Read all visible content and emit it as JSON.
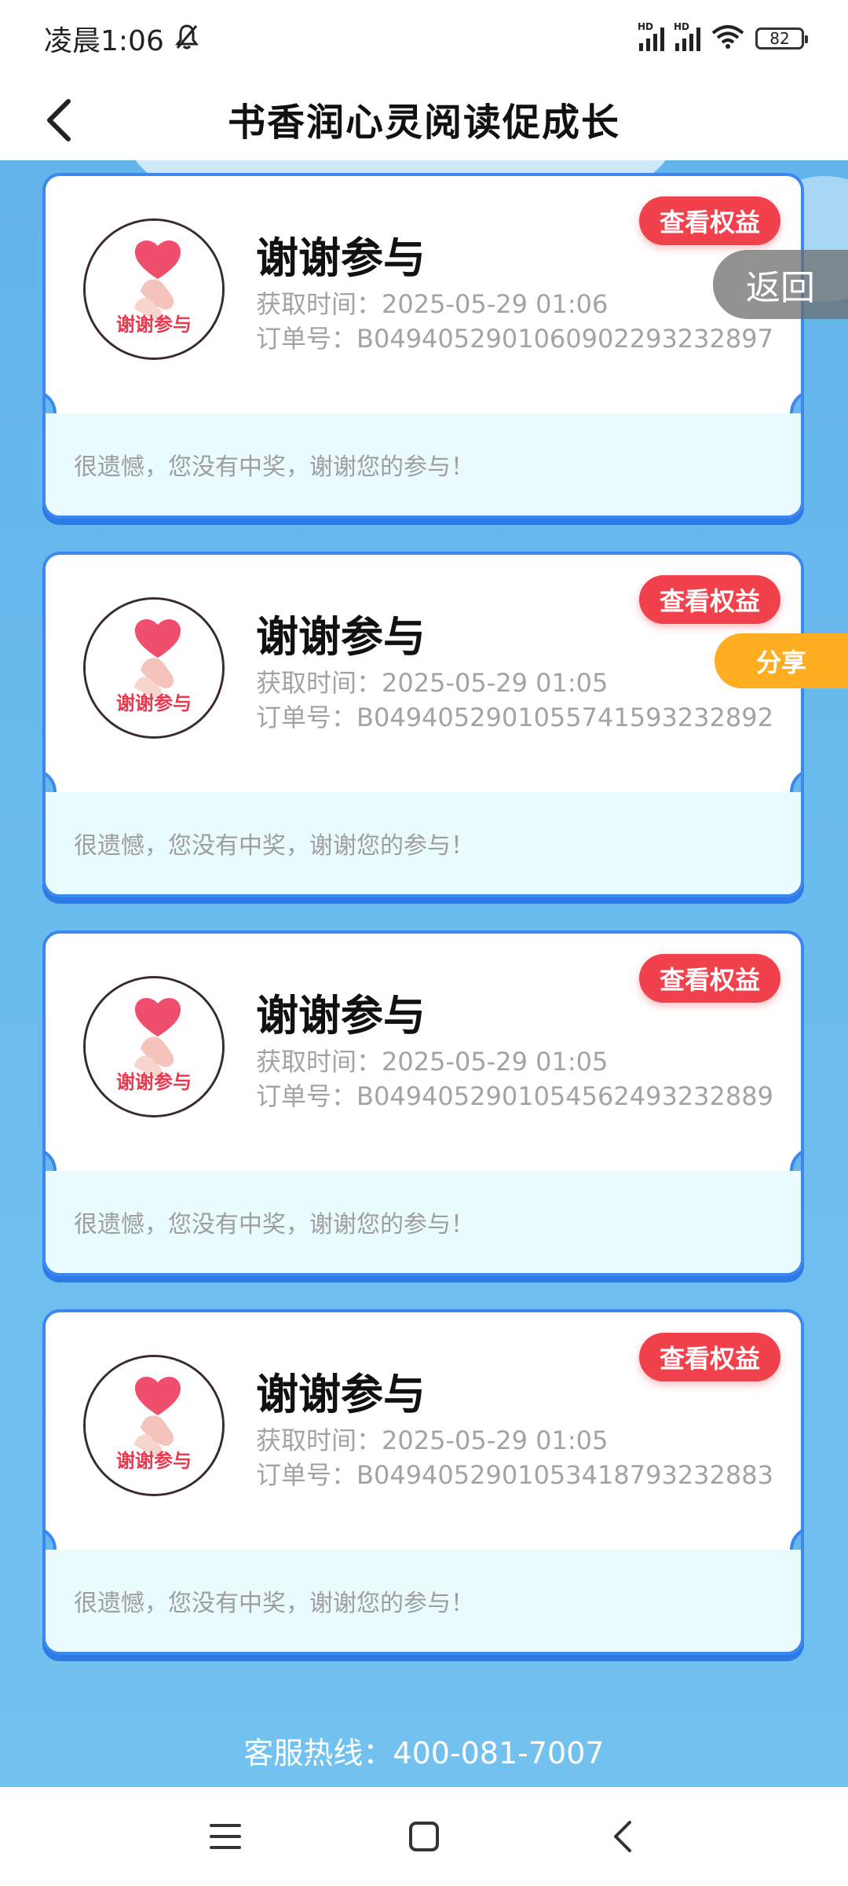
{
  "status_bar": {
    "time": "凌晨1:06",
    "battery": "82",
    "signal_label_1": "HD",
    "signal_label_2": "HD"
  },
  "header": {
    "title": "书香润心灵阅读促成长"
  },
  "floating": {
    "back_label": "返回",
    "share_label": "分享"
  },
  "cards": [
    {
      "prize_name": "谢谢参与",
      "image_text": "谢谢参与",
      "time_label": "获取时间：",
      "time_value": "2025-05-29 01:06",
      "order_label": "订单号：",
      "order_value": "B0494052901060902293232897",
      "benefit_label": "查看权益",
      "footer": "很遗憾，您没有中奖，谢谢您的参与！"
    },
    {
      "prize_name": "谢谢参与",
      "image_text": "谢谢参与",
      "time_label": "获取时间：",
      "time_value": "2025-05-29 01:05",
      "order_label": "订单号：",
      "order_value": "B0494052901055741593232892",
      "benefit_label": "查看权益",
      "footer": "很遗憾，您没有中奖，谢谢您的参与！"
    },
    {
      "prize_name": "谢谢参与",
      "image_text": "谢谢参与",
      "time_label": "获取时间：",
      "time_value": "2025-05-29 01:05",
      "order_label": "订单号：",
      "order_value": "B0494052901054562493232889",
      "benefit_label": "查看权益",
      "footer": "很遗憾，您没有中奖，谢谢您的参与！"
    },
    {
      "prize_name": "谢谢参与",
      "image_text": "谢谢参与",
      "time_label": "获取时间：",
      "time_value": "2025-05-29 01:05",
      "order_label": "订单号：",
      "order_value": "B0494052901053418793232883",
      "benefit_label": "查看权益",
      "footer": "很遗憾，您没有中奖，谢谢您的参与！"
    }
  ],
  "hotline": {
    "text": "客服热线：400-081-7007"
  },
  "colors": {
    "accent_red": "#f0414c",
    "share_orange": "#ffae22",
    "card_border": "#3d88ee",
    "background_blue": "#67b8ec"
  }
}
